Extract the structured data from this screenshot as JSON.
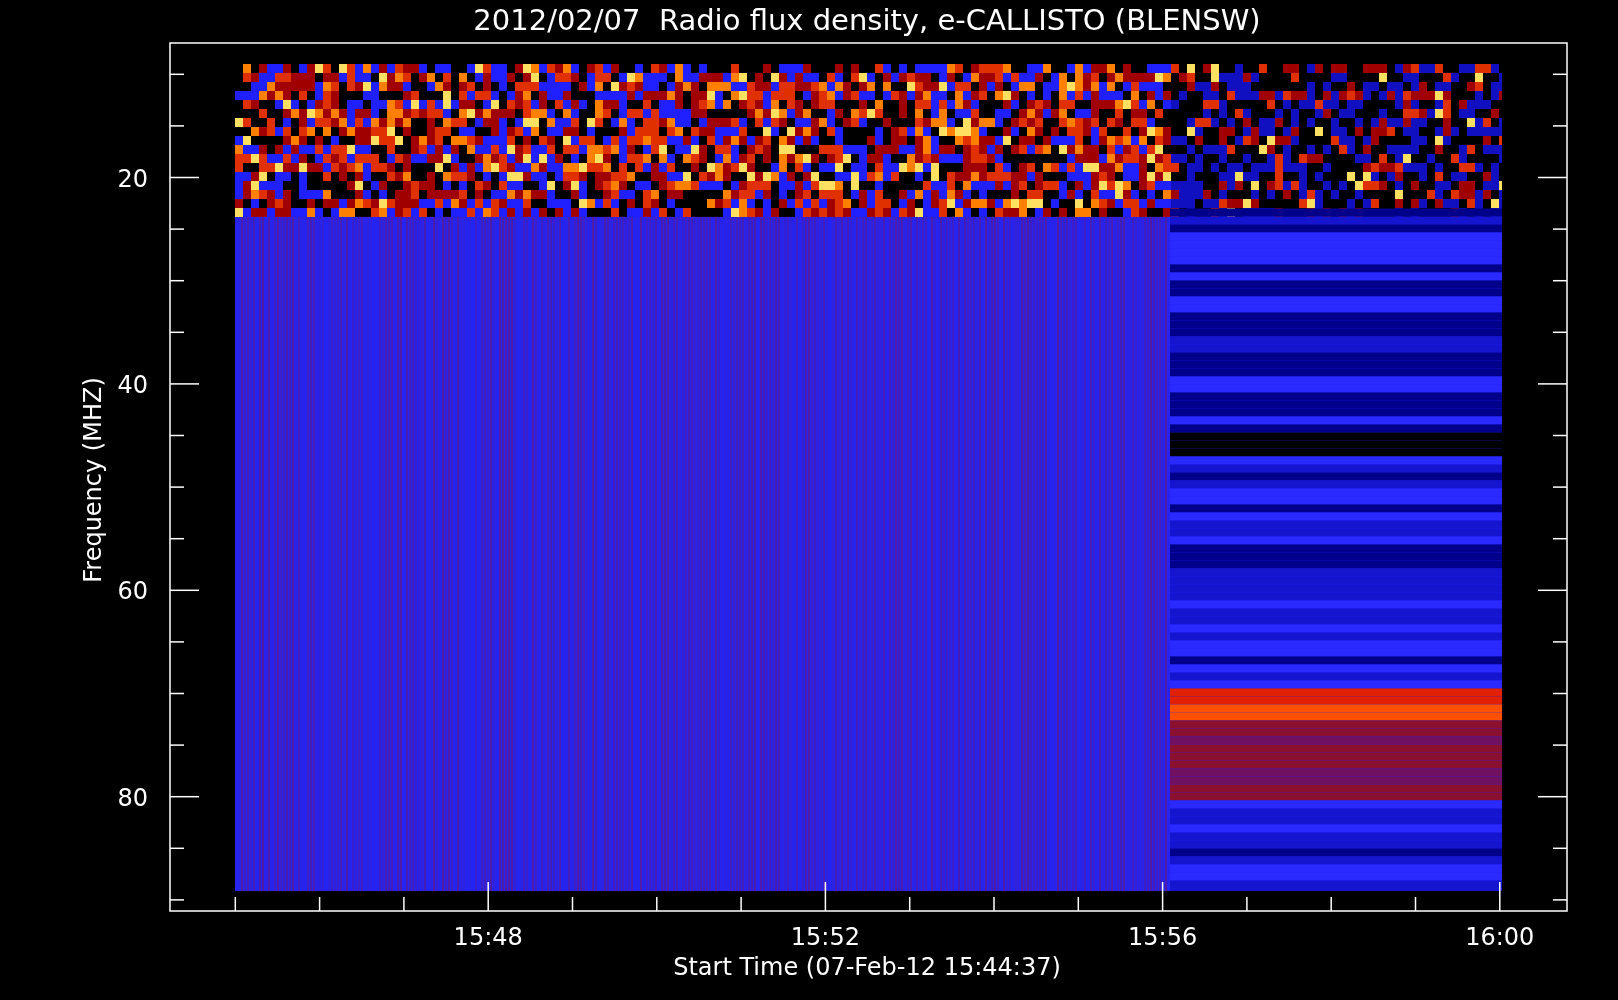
{
  "title": "2012/02/07  Radio flux density, e-CALLISTO (BLENSW)",
  "y_axis": {
    "label": "Frequency (MHZ)",
    "ticks": [
      "20",
      "40",
      "60",
      "80"
    ]
  },
  "x_axis": {
    "label": "Start Time (07-Feb-12 15:44:37)",
    "ticks": [
      "15:48",
      "15:52",
      "15:56",
      "16:00"
    ]
  }
}
